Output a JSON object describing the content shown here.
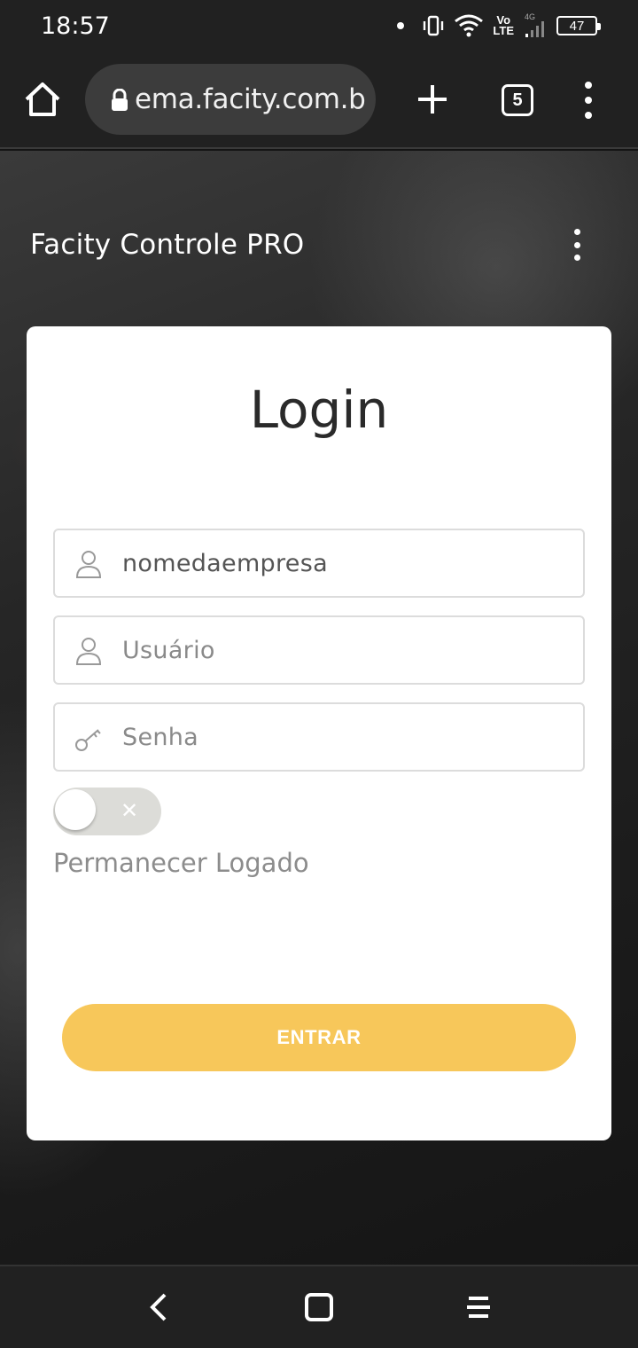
{
  "status_bar": {
    "time": "18:57",
    "network_label": "4G",
    "volte_label": "Vo\nLTE",
    "battery": "47"
  },
  "browser": {
    "url": "​ema.facity.com.br",
    "tab_count": "5"
  },
  "app": {
    "title": "Facity Controle PRO"
  },
  "login": {
    "title": "Login",
    "company_value": "nomedaempresa",
    "user_placeholder": "Usuário",
    "password_placeholder": "Senha",
    "remember_label": "Permanecer Logado",
    "remember_enabled": false,
    "submit_label": "ENTRAR"
  },
  "colors": {
    "accent": "#f7c75a",
    "bar_background": "#212121"
  }
}
